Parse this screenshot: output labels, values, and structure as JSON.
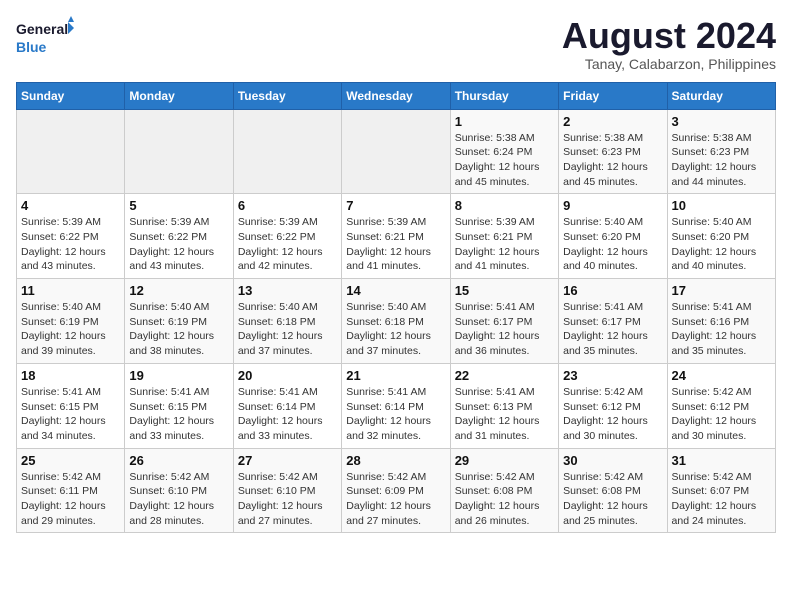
{
  "header": {
    "logo_line1": "General",
    "logo_line2": "Blue",
    "month_year": "August 2024",
    "location": "Tanay, Calabarzon, Philippines"
  },
  "weekdays": [
    "Sunday",
    "Monday",
    "Tuesday",
    "Wednesday",
    "Thursday",
    "Friday",
    "Saturday"
  ],
  "weeks": [
    [
      {
        "day": "",
        "sunrise": "",
        "sunset": "",
        "daylight": ""
      },
      {
        "day": "",
        "sunrise": "",
        "sunset": "",
        "daylight": ""
      },
      {
        "day": "",
        "sunrise": "",
        "sunset": "",
        "daylight": ""
      },
      {
        "day": "",
        "sunrise": "",
        "sunset": "",
        "daylight": ""
      },
      {
        "day": "1",
        "sunrise": "5:38 AM",
        "sunset": "6:24 PM",
        "daylight": "12 hours and 45 minutes."
      },
      {
        "day": "2",
        "sunrise": "5:38 AM",
        "sunset": "6:23 PM",
        "daylight": "12 hours and 45 minutes."
      },
      {
        "day": "3",
        "sunrise": "5:38 AM",
        "sunset": "6:23 PM",
        "daylight": "12 hours and 44 minutes."
      }
    ],
    [
      {
        "day": "4",
        "sunrise": "5:39 AM",
        "sunset": "6:22 PM",
        "daylight": "12 hours and 43 minutes."
      },
      {
        "day": "5",
        "sunrise": "5:39 AM",
        "sunset": "6:22 PM",
        "daylight": "12 hours and 43 minutes."
      },
      {
        "day": "6",
        "sunrise": "5:39 AM",
        "sunset": "6:22 PM",
        "daylight": "12 hours and 42 minutes."
      },
      {
        "day": "7",
        "sunrise": "5:39 AM",
        "sunset": "6:21 PM",
        "daylight": "12 hours and 41 minutes."
      },
      {
        "day": "8",
        "sunrise": "5:39 AM",
        "sunset": "6:21 PM",
        "daylight": "12 hours and 41 minutes."
      },
      {
        "day": "9",
        "sunrise": "5:40 AM",
        "sunset": "6:20 PM",
        "daylight": "12 hours and 40 minutes."
      },
      {
        "day": "10",
        "sunrise": "5:40 AM",
        "sunset": "6:20 PM",
        "daylight": "12 hours and 40 minutes."
      }
    ],
    [
      {
        "day": "11",
        "sunrise": "5:40 AM",
        "sunset": "6:19 PM",
        "daylight": "12 hours and 39 minutes."
      },
      {
        "day": "12",
        "sunrise": "5:40 AM",
        "sunset": "6:19 PM",
        "daylight": "12 hours and 38 minutes."
      },
      {
        "day": "13",
        "sunrise": "5:40 AM",
        "sunset": "6:18 PM",
        "daylight": "12 hours and 37 minutes."
      },
      {
        "day": "14",
        "sunrise": "5:40 AM",
        "sunset": "6:18 PM",
        "daylight": "12 hours and 37 minutes."
      },
      {
        "day": "15",
        "sunrise": "5:41 AM",
        "sunset": "6:17 PM",
        "daylight": "12 hours and 36 minutes."
      },
      {
        "day": "16",
        "sunrise": "5:41 AM",
        "sunset": "6:17 PM",
        "daylight": "12 hours and 35 minutes."
      },
      {
        "day": "17",
        "sunrise": "5:41 AM",
        "sunset": "6:16 PM",
        "daylight": "12 hours and 35 minutes."
      }
    ],
    [
      {
        "day": "18",
        "sunrise": "5:41 AM",
        "sunset": "6:15 PM",
        "daylight": "12 hours and 34 minutes."
      },
      {
        "day": "19",
        "sunrise": "5:41 AM",
        "sunset": "6:15 PM",
        "daylight": "12 hours and 33 minutes."
      },
      {
        "day": "20",
        "sunrise": "5:41 AM",
        "sunset": "6:14 PM",
        "daylight": "12 hours and 33 minutes."
      },
      {
        "day": "21",
        "sunrise": "5:41 AM",
        "sunset": "6:14 PM",
        "daylight": "12 hours and 32 minutes."
      },
      {
        "day": "22",
        "sunrise": "5:41 AM",
        "sunset": "6:13 PM",
        "daylight": "12 hours and 31 minutes."
      },
      {
        "day": "23",
        "sunrise": "5:42 AM",
        "sunset": "6:12 PM",
        "daylight": "12 hours and 30 minutes."
      },
      {
        "day": "24",
        "sunrise": "5:42 AM",
        "sunset": "6:12 PM",
        "daylight": "12 hours and 30 minutes."
      }
    ],
    [
      {
        "day": "25",
        "sunrise": "5:42 AM",
        "sunset": "6:11 PM",
        "daylight": "12 hours and 29 minutes."
      },
      {
        "day": "26",
        "sunrise": "5:42 AM",
        "sunset": "6:10 PM",
        "daylight": "12 hours and 28 minutes."
      },
      {
        "day": "27",
        "sunrise": "5:42 AM",
        "sunset": "6:10 PM",
        "daylight": "12 hours and 27 minutes."
      },
      {
        "day": "28",
        "sunrise": "5:42 AM",
        "sunset": "6:09 PM",
        "daylight": "12 hours and 27 minutes."
      },
      {
        "day": "29",
        "sunrise": "5:42 AM",
        "sunset": "6:08 PM",
        "daylight": "12 hours and 26 minutes."
      },
      {
        "day": "30",
        "sunrise": "5:42 AM",
        "sunset": "6:08 PM",
        "daylight": "12 hours and 25 minutes."
      },
      {
        "day": "31",
        "sunrise": "5:42 AM",
        "sunset": "6:07 PM",
        "daylight": "12 hours and 24 minutes."
      }
    ]
  ],
  "labels": {
    "sunrise_prefix": "Sunrise: ",
    "sunset_prefix": "Sunset: ",
    "daylight_prefix": "Daylight: "
  }
}
